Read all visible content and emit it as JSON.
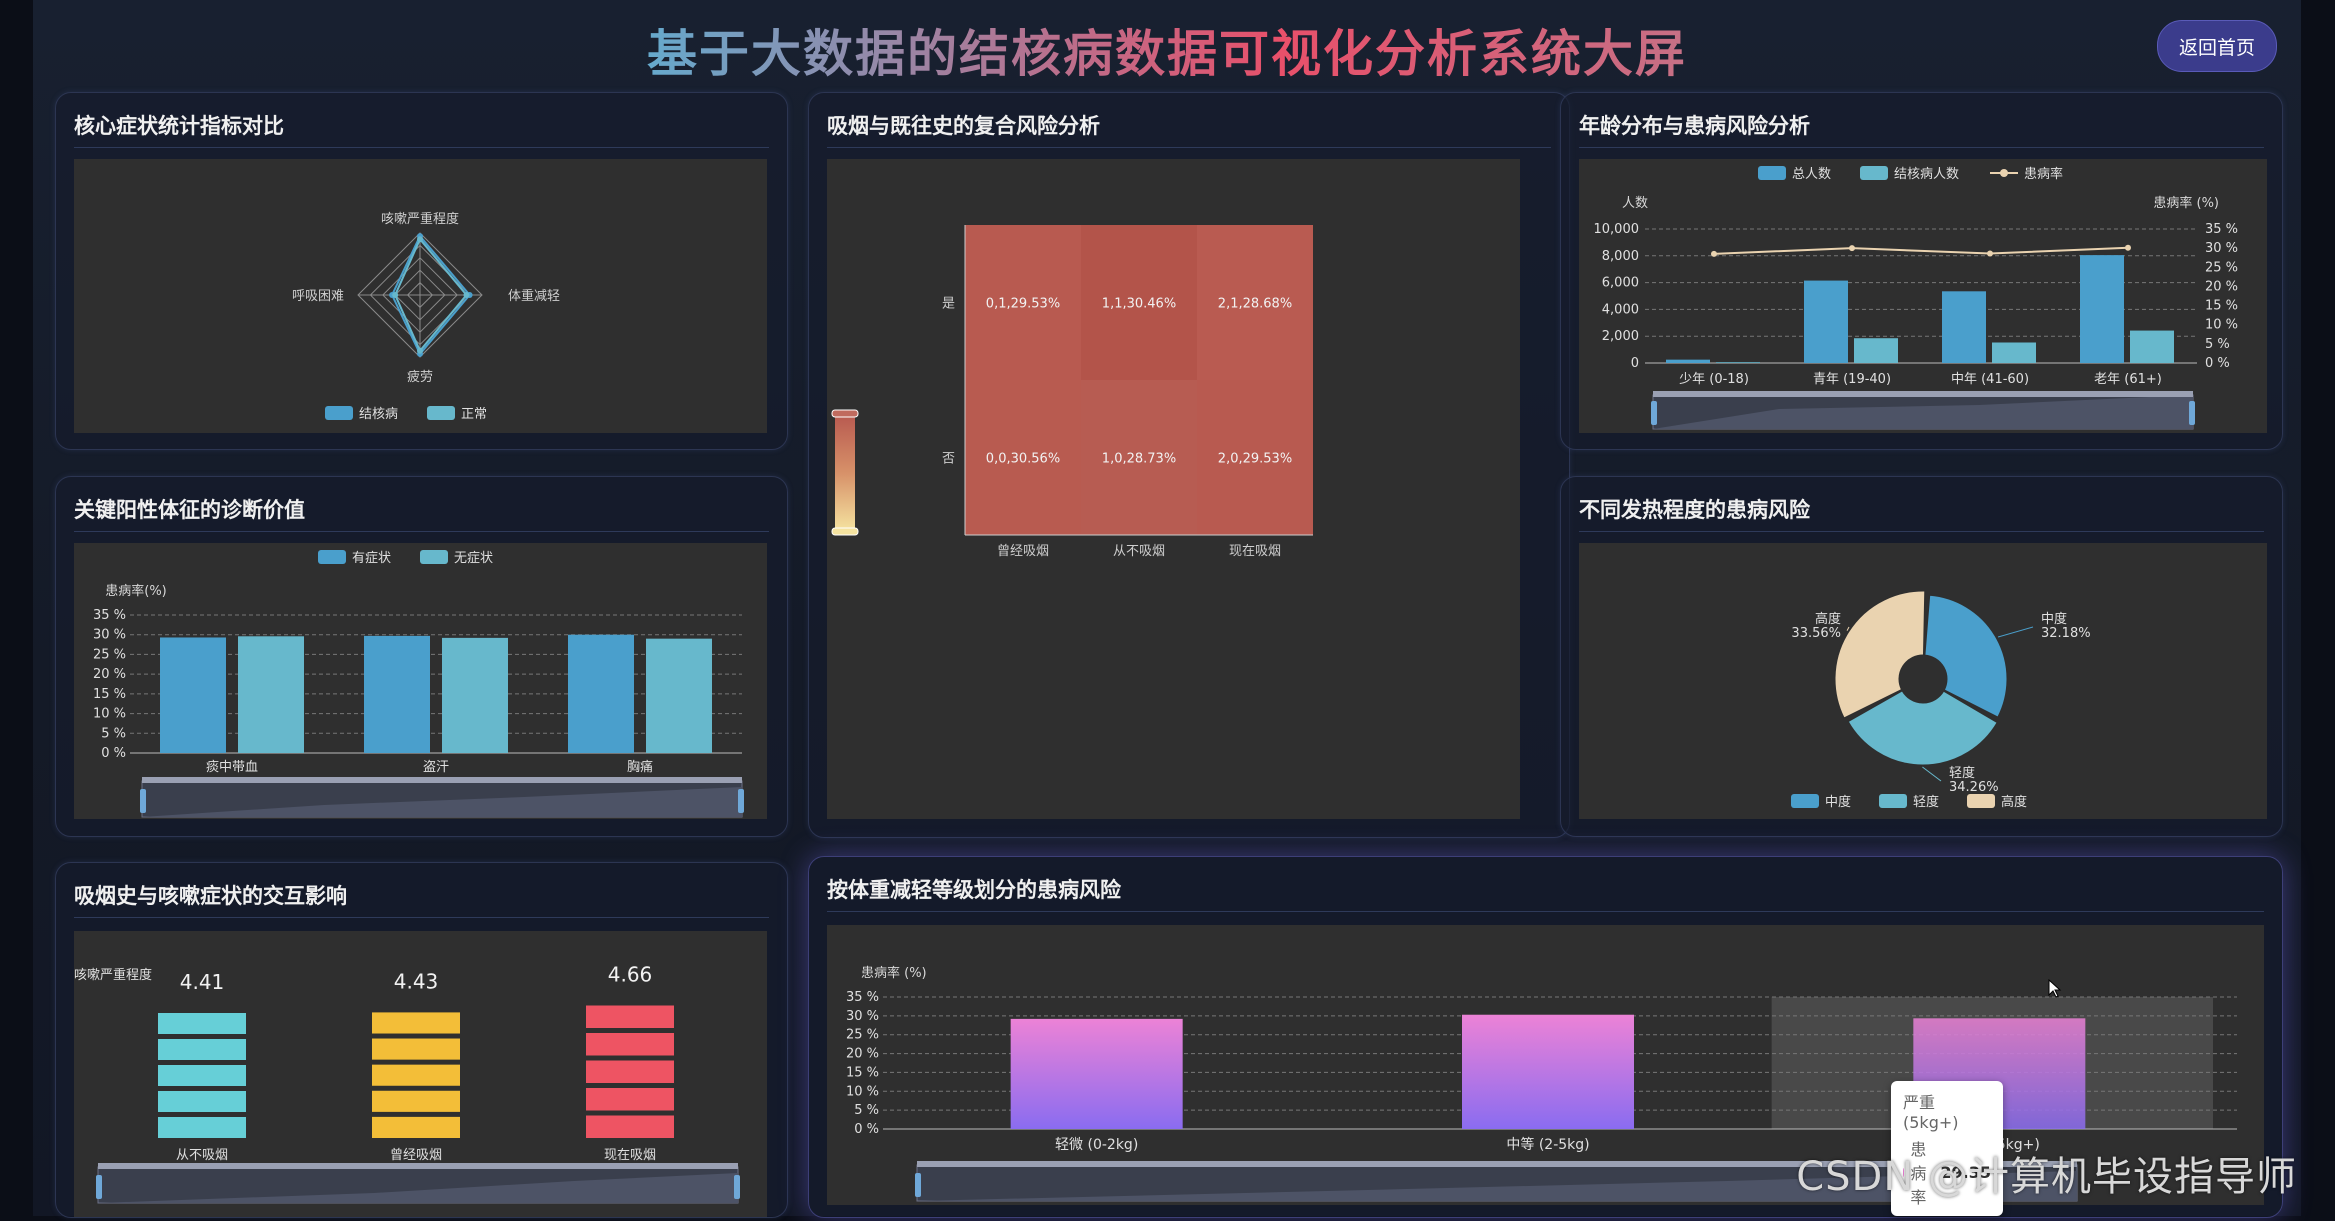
{
  "header": {
    "title": "基于大数据的结核病数据可视化分析系统大屏",
    "back_button": "返回首页"
  },
  "panels": {
    "radar": {
      "title": "核心症状统计指标对比"
    },
    "heatmap": {
      "title": "吸烟与既往史的复合风险分析"
    },
    "age": {
      "title": "年龄分布与患病风险分析"
    },
    "signs": {
      "title": "关键阳性体征的诊断价值"
    },
    "fever": {
      "title": "不同发热程度的患病风险"
    },
    "smoking": {
      "title": "吸烟史与咳嗽症状的交互影响"
    },
    "weight": {
      "title": "按体重减轻等级划分的患病风险"
    }
  },
  "tooltip": {
    "category": "严重 (5kg+)",
    "series": "患病率",
    "value": "29.35"
  },
  "watermark": "CSDN @计算机毕设指导师",
  "colors": {
    "blue": "#4a9fcc",
    "teal": "#67b8cc",
    "beige": "#ead3b0",
    "heat": "#b8574c",
    "pink_top": "#ec82d6",
    "purple_bottom": "#8a6cf0",
    "cyan_stack": "#66cfd7",
    "yellow_stack": "#f3be38",
    "red_stack": "#ee5463"
  },
  "chart_data": [
    {
      "id": "radar",
      "type": "radar",
      "indicators": [
        "咳嗽严重程度",
        "体重减轻",
        "疲劳",
        "呼吸困难"
      ],
      "series": [
        {
          "name": "结核病",
          "values": [
            0.95,
            0.8,
            0.95,
            0.45
          ]
        },
        {
          "name": "正常",
          "values": [
            0.9,
            0.75,
            0.9,
            0.4
          ]
        }
      ],
      "legend": [
        "结核病",
        "正常"
      ]
    },
    {
      "id": "heatmap",
      "type": "heatmap",
      "x_categories": [
        "曾经吸烟",
        "从不吸烟",
        "现在吸烟"
      ],
      "y_categories": [
        "否",
        "是"
      ],
      "cells": [
        {
          "x": 0,
          "y": 1,
          "label": "0,1,29.53%"
        },
        {
          "x": 1,
          "y": 1,
          "label": "1,1,30.46%"
        },
        {
          "x": 2,
          "y": 1,
          "label": "2,1,28.68%"
        },
        {
          "x": 0,
          "y": 0,
          "label": "0,0,30.56%"
        },
        {
          "x": 1,
          "y": 0,
          "label": "1,0,28.73%"
        },
        {
          "x": 2,
          "y": 0,
          "label": "2,0,29.53%"
        }
      ]
    },
    {
      "id": "age",
      "type": "bar",
      "categories": [
        "少年 (0-18)",
        "青年 (19-40)",
        "中年 (41-60)",
        "老年 (61+)"
      ],
      "series": [
        {
          "name": "总人数",
          "values": [
            250,
            6150,
            5350,
            8050
          ]
        },
        {
          "name": "结核病人数",
          "values": [
            60,
            1850,
            1530,
            2420
          ]
        },
        {
          "name": "患病率",
          "values": [
            28.5,
            30.0,
            28.6,
            30.1
          ]
        }
      ],
      "legend": [
        "总人数",
        "结核病人数",
        "患病率"
      ],
      "ylabel_left": "人数",
      "ylabel_right": "患病率 (%)",
      "yticks_left": [
        "10,000",
        "8,000",
        "6,000",
        "4,000",
        "2,000",
        "0"
      ],
      "yticks_right": [
        "35 %",
        "30 %",
        "25 %",
        "20 %",
        "15 %",
        "10 %",
        "5 %",
        "0 %"
      ],
      "ylim_left": [
        0,
        10000
      ],
      "ylim_right": [
        0,
        35
      ]
    },
    {
      "id": "signs",
      "type": "bar",
      "categories": [
        "痰中带血",
        "盗汗",
        "胸痛"
      ],
      "series": [
        {
          "name": "有症状",
          "values": [
            29.3,
            29.7,
            30.0
          ]
        },
        {
          "name": "无症状",
          "values": [
            29.6,
            29.2,
            29.0
          ]
        }
      ],
      "legend": [
        "有症状",
        "无症状"
      ],
      "ylabel": "患病率(%)",
      "yticks": [
        "35 %",
        "30 %",
        "25 %",
        "20 %",
        "15 %",
        "10 %",
        "5 %",
        "0 %"
      ],
      "ylim": [
        0,
        35
      ]
    },
    {
      "id": "fever",
      "type": "pie",
      "slices": [
        {
          "name": "中度",
          "value": 32.18,
          "label": "中度\n32.18%"
        },
        {
          "name": "轻度",
          "value": 34.26,
          "label": "轻度\n34.26%"
        },
        {
          "name": "高度",
          "value": 33.56,
          "label": "高度\n33.56%"
        }
      ],
      "legend": [
        "中度",
        "轻度",
        "高度"
      ]
    },
    {
      "id": "smoking",
      "type": "bar",
      "categories": [
        "从不吸烟",
        "曾经吸烟",
        "现在吸烟"
      ],
      "values": [
        4.41,
        4.43,
        4.66
      ],
      "value_labels": [
        "4.41",
        "4.43",
        "4.66"
      ],
      "ylabel": "咳嗽严重程度"
    },
    {
      "id": "weight",
      "type": "bar",
      "categories": [
        "轻微 (0-2kg)",
        "中等 (2-5kg)",
        "严重 (5kg+)"
      ],
      "values": [
        29.2,
        30.3,
        29.35
      ],
      "ylabel": "患病率 (%)",
      "yticks": [
        "35 %",
        "30 %",
        "25 %",
        "20 %",
        "15 %",
        "10 %",
        "5 %",
        "0 %"
      ],
      "ylim": [
        0,
        35
      ]
    }
  ]
}
